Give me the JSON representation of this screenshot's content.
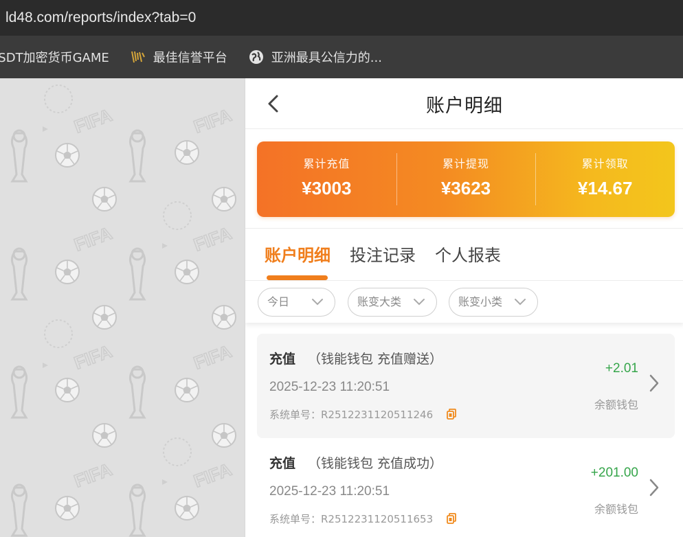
{
  "browser": {
    "url": "ld48.com/reports/index?tab=0",
    "bookmarks": [
      {
        "label": "JSDT加密货币GAME",
        "icon": "none"
      },
      {
        "label": "最佳信誉平台",
        "icon": "brand-logo-icon"
      },
      {
        "label": "亚洲最具公信力的...",
        "icon": "globe-icon"
      }
    ]
  },
  "nav": {
    "title": "账户明细",
    "back_icon": "chevron-left-icon"
  },
  "summary": [
    {
      "label": "累计充值",
      "value": "¥3003"
    },
    {
      "label": "累计提现",
      "value": "¥3623"
    },
    {
      "label": "累计领取",
      "value": "¥14.67"
    }
  ],
  "tabs": [
    {
      "label": "账户明细",
      "active": true
    },
    {
      "label": "投注记录",
      "active": false
    },
    {
      "label": "个人报表",
      "active": false
    }
  ],
  "filters": [
    {
      "label": "今日",
      "icon": "chevron-down-icon"
    },
    {
      "label": "账变大类",
      "icon": "chevron-down-icon"
    },
    {
      "label": "账变小类",
      "icon": "chevron-down-icon"
    }
  ],
  "records": [
    {
      "type": "充值",
      "detail": "（钱能钱包 充值赠送）",
      "time": "2025-12-23 11:20:51",
      "order": "系统单号：R2512231120511246",
      "amount": "+2.01",
      "wallet": "余额钱包"
    },
    {
      "type": "充值",
      "detail": "（钱能钱包 充值成功）",
      "time": "2025-12-23 11:20:51",
      "order": "系统单号：R2512231120511653",
      "amount": "+201.00",
      "wallet": "余额钱包"
    }
  ],
  "colors": {
    "accent": "#f07e1c",
    "positive": "#35a54a",
    "gradient_start": "#f47226",
    "gradient_end": "#f3c61c"
  }
}
